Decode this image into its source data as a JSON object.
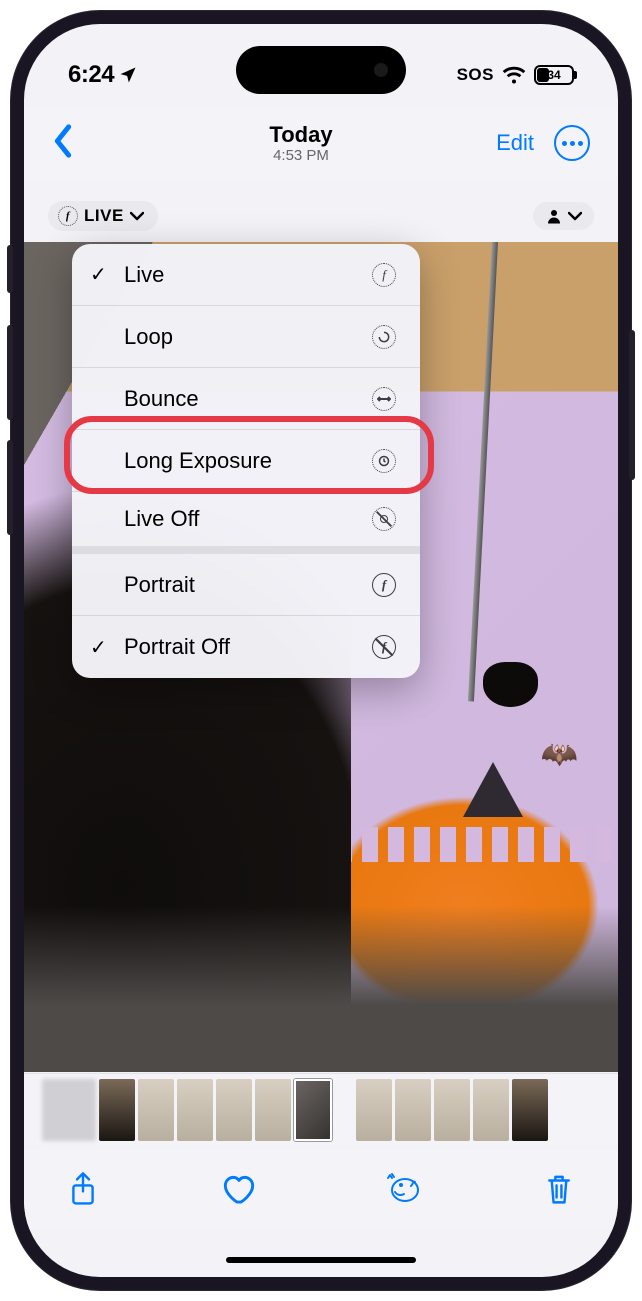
{
  "status": {
    "time": "6:24",
    "sos": "SOS",
    "battery_percent": "34",
    "battery_fill_pct": 34
  },
  "nav": {
    "title": "Today",
    "subtitle": "4:53 PM",
    "edit_label": "Edit"
  },
  "badges": {
    "live_label": "LIVE"
  },
  "menu": {
    "items": [
      {
        "label": "Live",
        "checked": true
      },
      {
        "label": "Loop",
        "checked": false
      },
      {
        "label": "Bounce",
        "checked": false
      },
      {
        "label": "Long Exposure",
        "checked": false
      },
      {
        "label": "Live Off",
        "checked": false
      },
      {
        "label": "Portrait",
        "checked": false
      },
      {
        "label": "Portrait Off",
        "checked": true
      }
    ]
  },
  "highlighted_index": 3
}
